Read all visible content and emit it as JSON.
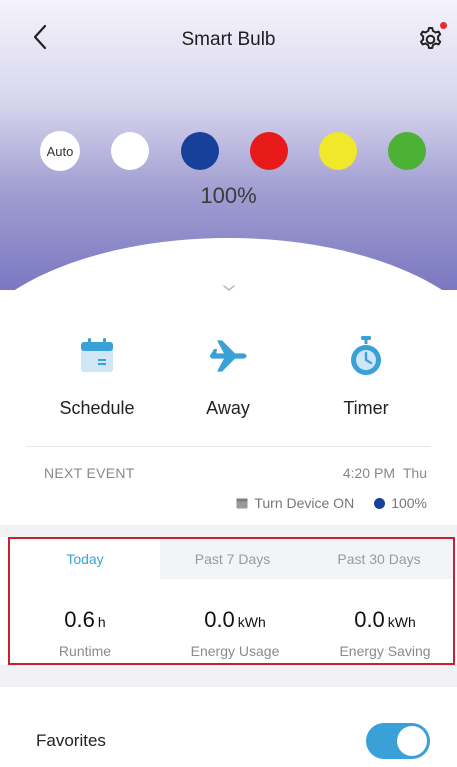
{
  "header": {
    "title": "Smart Bulb"
  },
  "colors": {
    "accent": "#3aa1d8",
    "highlight_border": "#c8202e",
    "swatches": [
      "#ffffff",
      "#17409a",
      "#e81919",
      "#f0e82a",
      "#4cb134"
    ]
  },
  "swatches": {
    "auto_label": "Auto"
  },
  "brightness": {
    "label": "100%"
  },
  "modes": [
    {
      "label": "Schedule",
      "icon": "calendar-icon"
    },
    {
      "label": "Away",
      "icon": "airplane-icon"
    },
    {
      "label": "Timer",
      "icon": "stopwatch-icon"
    }
  ],
  "next_event": {
    "label": "NEXT EVENT",
    "time": "4:20 PM",
    "day": "Thu",
    "action": "Turn Device ON",
    "brightness": "100%"
  },
  "usage": {
    "tabs": [
      "Today",
      "Past 7 Days",
      "Past 30 Days"
    ],
    "active_tab": "Today",
    "stats": [
      {
        "value": "0.6",
        "unit": "h",
        "label": "Runtime"
      },
      {
        "value": "0.0",
        "unit": "kWh",
        "label": "Energy Usage"
      },
      {
        "value": "0.0",
        "unit": "kWh",
        "label": "Energy Saving"
      }
    ]
  },
  "favorites": {
    "label": "Favorites",
    "enabled": true
  }
}
